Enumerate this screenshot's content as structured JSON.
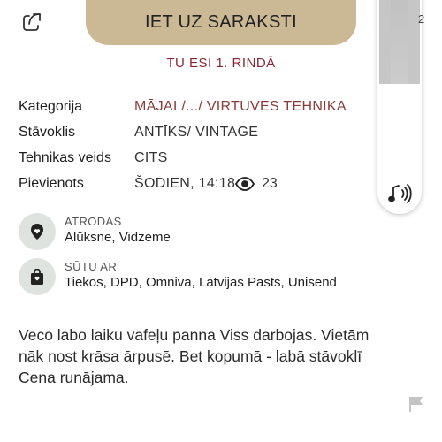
{
  "header": {
    "primary_button": "IET UZ SARAKSTI",
    "queue_status": "TU ESI 1. RINDĀ",
    "edge_number": "2"
  },
  "details": {
    "category_label": "Kategorija",
    "category_value": "MĀJAI /.../ VIRTUVES TEHNIKA",
    "condition_label": "Stāvoklis",
    "condition_value": "ANTĪKS/ VINTAGE",
    "type_label": "Tehnikas veids",
    "type_value": "CITS",
    "added_label": "Pievienots",
    "added_value": "ŠODIEN, 14:18",
    "views": "23"
  },
  "location": {
    "caption": "ATRODAS",
    "value": "Alūksne, Vidzeme"
  },
  "shipping": {
    "caption": "SŪTU AR",
    "value": "Tiekos, DPD, Omniva, Latvijas Pasts, Unisend"
  },
  "description": {
    "line1": "Veco labo laiku vafeļu panna  Viss darbojas. Vietām",
    "line2": "nāk nost krāsa ārpusē. Bet kopumā - labā stāvoklī",
    "line3": "Cena runājama."
  },
  "icons": {
    "share": "share-icon",
    "audio": "audio-icon",
    "eye": "eye-icon",
    "location": "location-pin-icon",
    "shipping": "shopping-bag-icon",
    "flag": "flag-icon"
  },
  "colors": {
    "primary_button": "#cbb894",
    "queue_status": "#8b2533",
    "category_link": "#8b3a3a",
    "icon_circle": "#dfe3e0"
  }
}
